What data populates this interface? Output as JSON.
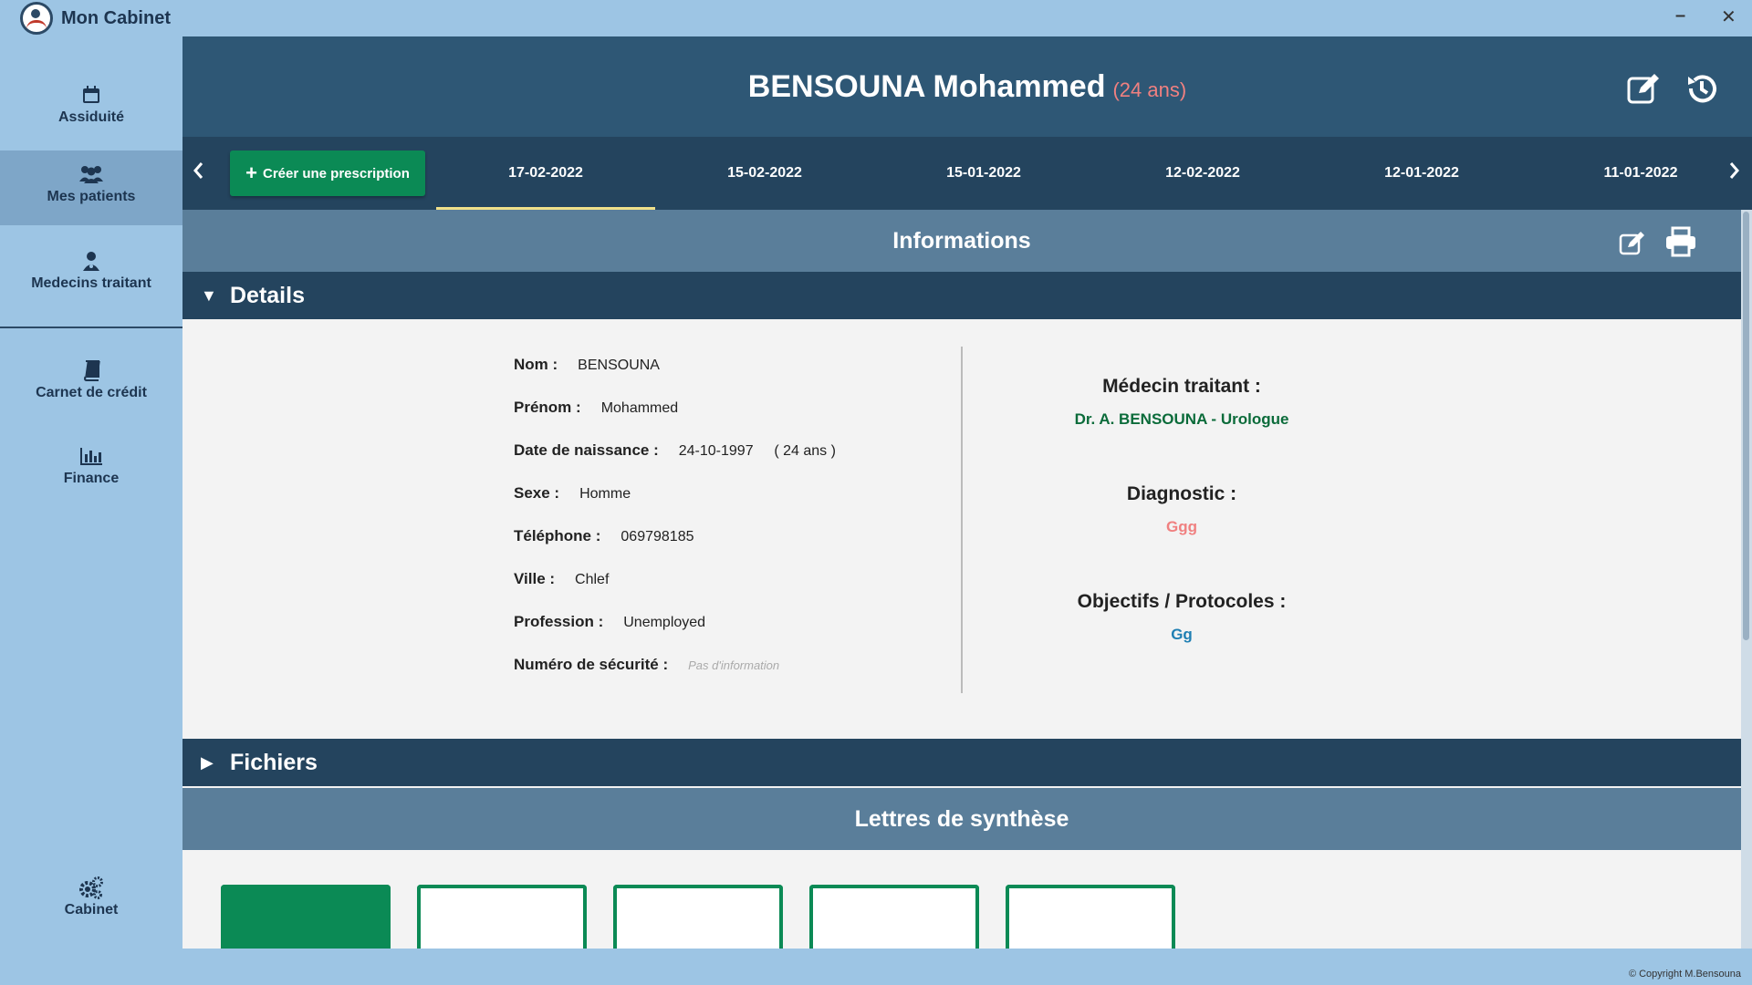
{
  "app": {
    "title": "Mon Cabinet",
    "minimize": "–",
    "close": "✕"
  },
  "sidebar": {
    "items": [
      {
        "label": "Assiduité",
        "icon": "calendar-icon",
        "glyph": "📅"
      },
      {
        "label": "Mes patients",
        "icon": "users-icon",
        "glyph": "👥"
      },
      {
        "label": "Medecins traitant",
        "icon": "doctor-icon",
        "glyph": "⚕"
      },
      {
        "label": "Carnet de crédit",
        "icon": "book-icon",
        "glyph": "📖"
      },
      {
        "label": "Finance",
        "icon": "chart-icon",
        "glyph": "📊"
      },
      {
        "label": "Cabinet",
        "icon": "gears-icon",
        "glyph": "⚙"
      }
    ]
  },
  "header": {
    "patient_name": "BENSOUNA Mohammed",
    "patient_age": "(24 ans)"
  },
  "datebar": {
    "create_label": "Créer une prescription",
    "dates": [
      "17-02-2022",
      "15-02-2022",
      "15-01-2022",
      "12-02-2022",
      "12-01-2022",
      "11-01-2022"
    ]
  },
  "informations": {
    "title": "Informations",
    "details_title": "Details",
    "fields": {
      "nom": {
        "label": "Nom :",
        "value": "BENSOUNA"
      },
      "prenom": {
        "label": "Prénom :",
        "value": "Mohammed"
      },
      "naissance": {
        "label": "Date de naissance :",
        "value": "24-10-1997",
        "extra": "( 24 ans )"
      },
      "sexe": {
        "label": "Sexe :",
        "value": "Homme"
      },
      "telephone": {
        "label": "Téléphone :",
        "value": "069798185"
      },
      "ville": {
        "label": "Ville :",
        "value": "Chlef"
      },
      "profession": {
        "label": "Profession :",
        "value": "Unemployed"
      },
      "securite": {
        "label": "Numéro de sécurité :",
        "value": "Pas d'information"
      }
    },
    "medecin_label": "Médecin traitant :",
    "medecin_value": "Dr. A. BENSOUNA - Urologue",
    "diagnostic_label": "Diagnostic :",
    "diagnostic_value": "Ggg",
    "objectifs_label": "Objectifs / Protocoles :",
    "objectifs_value": "Gg"
  },
  "fichiers_title": "Fichiers",
  "lettres_title": "Lettres de synthèse",
  "footer": "© Copyright M.Bensouna",
  "colors": {
    "accent": "#0b8a55",
    "header": "#2e5775",
    "medecin": "#0b6b3a",
    "diagnostic": "#f08080",
    "objectifs": "#1f7fb3"
  }
}
